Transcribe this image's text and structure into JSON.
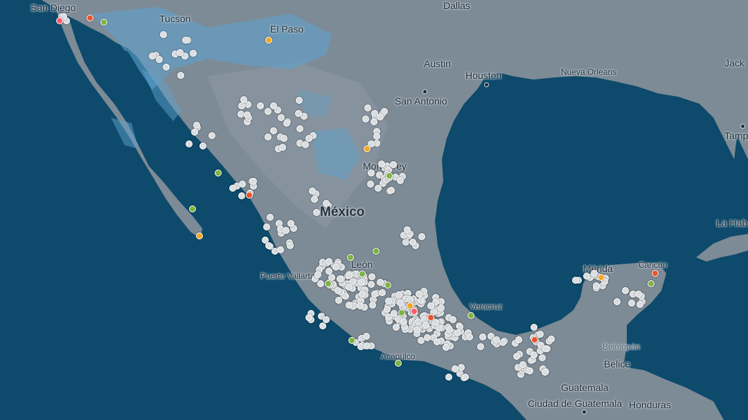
{
  "map": {
    "country_label": "México",
    "colors": {
      "water": "#0d4a6b",
      "land": "#7d8b96",
      "land_light": "#8e9ba5",
      "wet_areas": "#5fa2cc",
      "station_default": "#d9dde0",
      "station_good": "#7cb342",
      "station_moderate": "#f5a623",
      "station_bad": "#e8542c",
      "station_very_bad": "#ff5c6c"
    },
    "cities": [
      {
        "label": "San Diego",
        "size": "normal"
      },
      {
        "label": "Tucson",
        "size": "normal"
      },
      {
        "label": "El Paso",
        "size": "normal"
      },
      {
        "label": "Dallas",
        "size": "normal"
      },
      {
        "label": "Austin",
        "size": "normal"
      },
      {
        "label": "Houston",
        "size": "normal"
      },
      {
        "label": "Nueva Orleans",
        "size": "small"
      },
      {
        "label": "Jack",
        "size": "normal"
      },
      {
        "label": "San Antonio",
        "size": "normal"
      },
      {
        "label": "Tamp",
        "size": "normal"
      },
      {
        "label": "Monterrey",
        "size": "normal"
      },
      {
        "label": "La Hab",
        "size": "normal"
      },
      {
        "label": "Mérida",
        "size": "normal"
      },
      {
        "label": "Cancún",
        "size": "small"
      },
      {
        "label": "León",
        "size": "normal"
      },
      {
        "label": "Puerto Vallarta",
        "size": "small"
      },
      {
        "label": "Veracruz",
        "size": "small"
      },
      {
        "label": "Acapulco",
        "size": "small"
      },
      {
        "label": "Belmopán",
        "size": "faint"
      },
      {
        "label": "Belice",
        "size": "normal"
      },
      {
        "label": "Guatemala",
        "size": "normal"
      },
      {
        "label": "Honduras",
        "size": "normal"
      },
      {
        "label": "Ciudad de Guatemala",
        "size": "normal"
      }
    ]
  }
}
